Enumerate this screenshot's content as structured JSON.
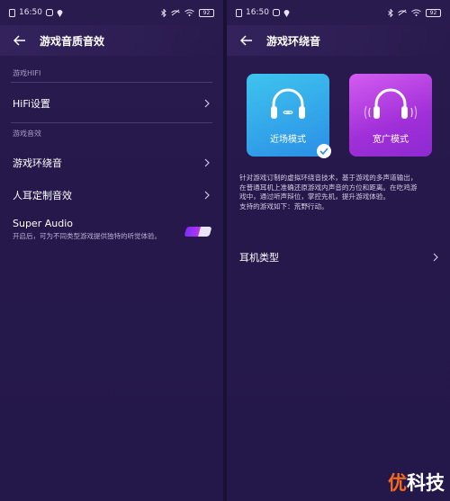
{
  "status_bar": {
    "time": "16:50",
    "battery": "92"
  },
  "left": {
    "title": "游戏音质音效",
    "section_hifi": "游戏HIFI",
    "hifi_settings": "HiFi设置",
    "section_effects": "游戏音效",
    "game_surround": "游戏环绕音",
    "custom_ear": "人耳定制音效",
    "super_audio": {
      "title": "Super Audio",
      "desc": "开启后，可为不同类型游戏提供独特的听觉体验。",
      "enabled": true
    }
  },
  "right": {
    "title": "游戏环绕音",
    "modes": [
      {
        "label": "近场模式",
        "selected": true
      },
      {
        "label": "宽广模式",
        "selected": false
      }
    ],
    "description_lines": [
      "针对游戏订制的虚拟环绕音技术，基于游戏的多声道输出，",
      "在普通耳机上准确还原游戏内声音的方位和距离。在吃鸡游",
      "戏中，通过听声辩位，掌控先机，提升游戏体验。",
      "支持的游戏如下：荒野行动。"
    ],
    "headphone_type": "耳机类型"
  },
  "watermark": {
    "part1": "优",
    "part2": "科技"
  },
  "colors": {
    "background": "#27194a",
    "near_card": "#3ec4ee",
    "wide_card": "#b63fe3",
    "toggle_on": "#7b2ff7",
    "watermark_accent": "#f26b1d"
  }
}
